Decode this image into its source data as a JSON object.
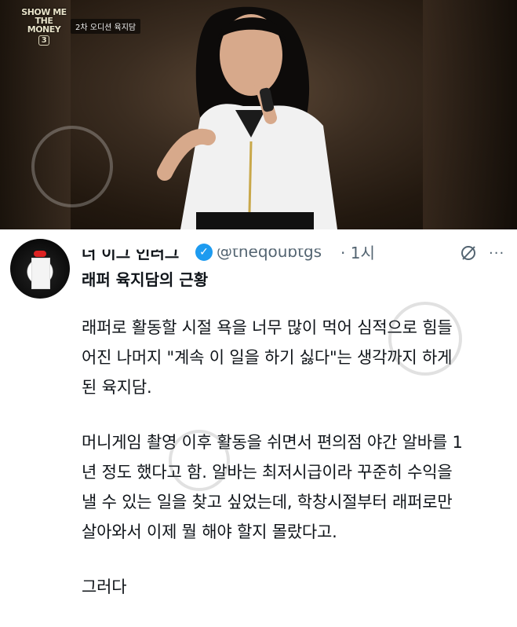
{
  "video": {
    "show_logo_line1": "SHOW ME",
    "show_logo_line2": "THE MONEY",
    "show_logo_number": "3",
    "caption": "2차 오디션 육지담"
  },
  "tweet": {
    "display_name": "더 이그 인러그",
    "handle": "@theqoubtgs",
    "timestamp": "· 1시",
    "headline": "래퍼 육지담의 근황",
    "paragraphs": [
      [
        "래퍼로 활동할 시절 욕을 너무 많이 먹어 심적으로 힘들",
        "어진 나머지 \"계속 이 일을 하기 싫다\"는 생각까지 하게",
        "된 육지담."
      ],
      [
        "머니게임 촬영 이후 활동을 쉬면서 편의점 야간 알바를 1",
        "년 정도 했다고 함. 알바는 최저시급이라 꾸준히 수익을",
        "낼 수 있는 일을 찾고 싶었는데, 학창시절부터 래퍼로만",
        "살아와서 이제 뭘 해야 할지 몰랐다고."
      ],
      [
        "그러다"
      ]
    ],
    "icons": {
      "verified": "verified-badge-icon",
      "grok": "grok-icon",
      "more": "more-options-icon"
    },
    "colors": {
      "verified": "#1d9bf0",
      "secondary": "#536471",
      "text": "#0f1419"
    }
  }
}
